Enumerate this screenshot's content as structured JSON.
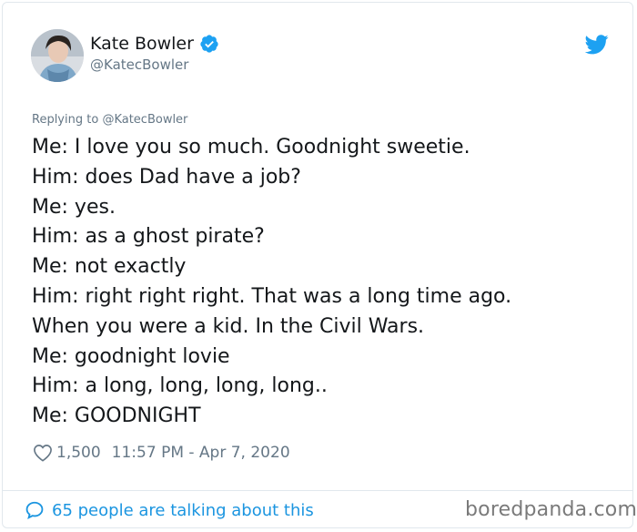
{
  "author": {
    "name": "Kate Bowler",
    "handle": "@KatecBowler",
    "verified": true
  },
  "reply": {
    "prefix": "Replying to",
    "to": "@KatecBowler"
  },
  "tweet": {
    "lines": [
      "Me: I love you so much. Goodnight sweetie.",
      "Him: does Dad have a job?",
      "Me: yes.",
      "Him: as a ghost pirate?",
      "Me: not exactly",
      "Him: right right right. That was a long time ago.",
      "When you were a kid. In the Civil Wars.",
      "Me: goodnight lovie",
      "Him: a long, long, long, long..",
      "Me: GOODNIGHT"
    ],
    "likes": "1,500",
    "timestamp": "11:57 PM - Apr 7, 2020"
  },
  "footer": {
    "talking": "65 people are talking about this",
    "watermark": "boredpanda.com"
  },
  "colors": {
    "accent": "#1b95e0",
    "muted": "#657786",
    "text": "#14171a",
    "border": "#e1e8ed"
  },
  "icons": {
    "verified": "verified-badge-icon",
    "brand": "twitter-bird-icon",
    "like": "heart-icon",
    "reply": "speech-bubble-icon"
  }
}
